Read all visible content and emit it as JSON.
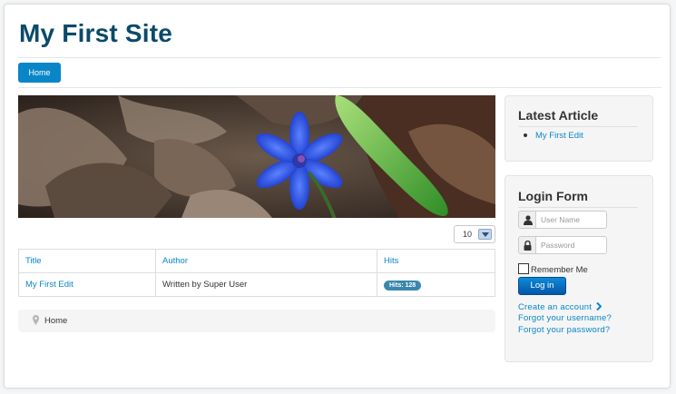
{
  "site": {
    "title": "My First Site"
  },
  "nav": {
    "items": [
      {
        "label": "Home"
      }
    ]
  },
  "list_limit": {
    "value": "10"
  },
  "articles_table": {
    "headers": [
      "Title",
      "Author",
      "Hits"
    ],
    "rows": [
      {
        "title": "My First Edit",
        "author": "Written by Super User",
        "hits": "Hits: 128"
      }
    ]
  },
  "breadcrumb": {
    "items": [
      "Home"
    ]
  },
  "latest_module": {
    "title": "Latest Article",
    "items": [
      "My First Edit"
    ]
  },
  "login_module": {
    "title": "Login Form",
    "username_placeholder": "User Name",
    "password_placeholder": "Password",
    "remember_label": "Remember Me",
    "login_button": "Log in",
    "create_account": "Create an account",
    "forgot_username": "Forgot your username?",
    "forgot_password": "Forgot your password?"
  },
  "colors": {
    "title": "#0b4a69",
    "accent": "#0a86c8",
    "badge": "#3a87ad"
  },
  "icons": {
    "breadcrumb": "map-pin-icon",
    "username": "user-icon",
    "password": "lock-icon",
    "create_account": "chevron-right-icon"
  }
}
